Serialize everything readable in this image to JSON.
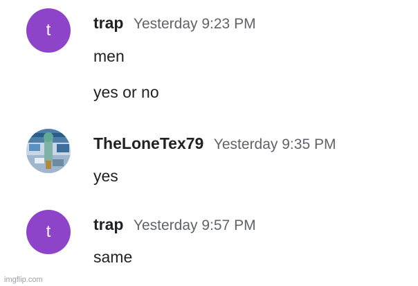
{
  "colors": {
    "avatar_bg": "#8e44c9",
    "name_text": "#202124",
    "timestamp_text": "#5f6368"
  },
  "messages": [
    {
      "avatar_letter": "t",
      "author": "trap",
      "timestamp": "Yesterday 9:23 PM",
      "lines": [
        "men",
        "yes or no"
      ]
    },
    {
      "avatar_icon": "profile-photo-icon",
      "author": "TheLoneTex79",
      "timestamp": "Yesterday 9:35 PM",
      "lines": [
        "yes"
      ]
    },
    {
      "avatar_letter": "t",
      "author": "trap",
      "timestamp": "Yesterday 9:57 PM",
      "lines": [
        "same"
      ]
    }
  ],
  "watermark": "imgflip.com"
}
